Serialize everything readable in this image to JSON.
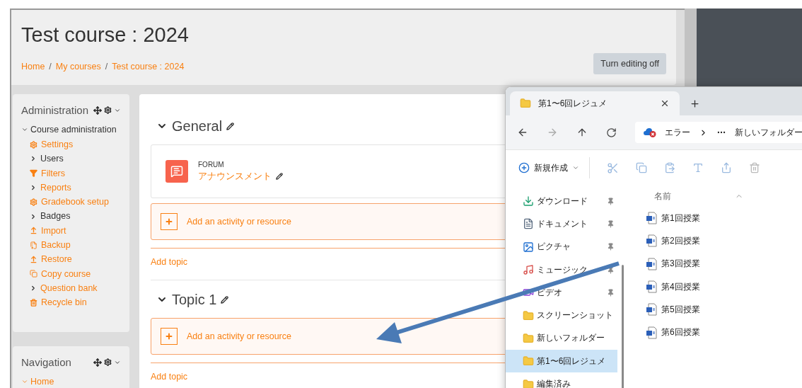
{
  "course": {
    "title": "Test course : 2024",
    "breadcrumb": [
      "Home",
      "My courses",
      "Test course : 2024"
    ],
    "separator": "/",
    "edit_button": "Turn editing off"
  },
  "administration": {
    "title": "Administration",
    "section": "Course administration",
    "expanded": true,
    "items": [
      {
        "label": "Settings",
        "kind": "gear",
        "link": true
      },
      {
        "label": "Users",
        "kind": "chevron",
        "link": false
      },
      {
        "label": "Filters",
        "kind": "filter",
        "link": true
      },
      {
        "label": "Reports",
        "kind": "chevron",
        "link": true
      },
      {
        "label": "Gradebook setup",
        "kind": "gear",
        "link": true
      },
      {
        "label": "Badges",
        "kind": "chevron",
        "link": false
      },
      {
        "label": "Import",
        "kind": "upload",
        "link": true
      },
      {
        "label": "Backup",
        "kind": "backup",
        "link": true
      },
      {
        "label": "Restore",
        "kind": "upload",
        "link": true
      },
      {
        "label": "Copy course",
        "kind": "copy",
        "link": true
      },
      {
        "label": "Question bank",
        "kind": "chevron",
        "link": true
      },
      {
        "label": "Recycle bin",
        "kind": "trash",
        "link": true
      }
    ]
  },
  "navigation": {
    "title": "Navigation",
    "items": [
      {
        "label": "Home",
        "expanded": true
      }
    ]
  },
  "sections": [
    {
      "title": "General",
      "expanded": true,
      "activities": [
        {
          "type": "FORUM",
          "name": "アナウンスメント"
        }
      ],
      "add_activity": "Add an activity or resource",
      "add_topic": "Add topic"
    },
    {
      "title": "Topic 1",
      "expanded": true,
      "add_activity": "Add an activity or resource",
      "add_topic": "Add topic"
    }
  ],
  "explorer": {
    "tab": "第1〜6回レジュメ",
    "address": {
      "status": "エラー",
      "path": "新しいフォルダー"
    },
    "toolbar": {
      "new_label": "新規作成"
    },
    "nav_items": [
      {
        "label": "ダウンロード",
        "kind": "download",
        "pinned": true,
        "selected": false
      },
      {
        "label": "ドキュメント",
        "kind": "document",
        "pinned": true,
        "selected": false
      },
      {
        "label": "ピクチャ",
        "kind": "picture",
        "pinned": true,
        "selected": false
      },
      {
        "label": "ミュージック",
        "kind": "music",
        "pinned": true,
        "selected": false
      },
      {
        "label": "ビデオ",
        "kind": "video",
        "pinned": true,
        "selected": false
      },
      {
        "label": "スクリーンショット",
        "kind": "folder",
        "pinned": false,
        "selected": false
      },
      {
        "label": "新しいフォルダー",
        "kind": "folder",
        "pinned": false,
        "selected": false
      },
      {
        "label": "第1〜6回レジュメ",
        "kind": "folder",
        "pinned": false,
        "selected": true
      },
      {
        "label": "編集済み",
        "kind": "folder",
        "pinned": false,
        "selected": false
      }
    ],
    "column": "名前",
    "files": [
      "第1回授業",
      "第2回授業",
      "第3回授業",
      "第4回授業",
      "第5回授業",
      "第6回授業"
    ]
  }
}
